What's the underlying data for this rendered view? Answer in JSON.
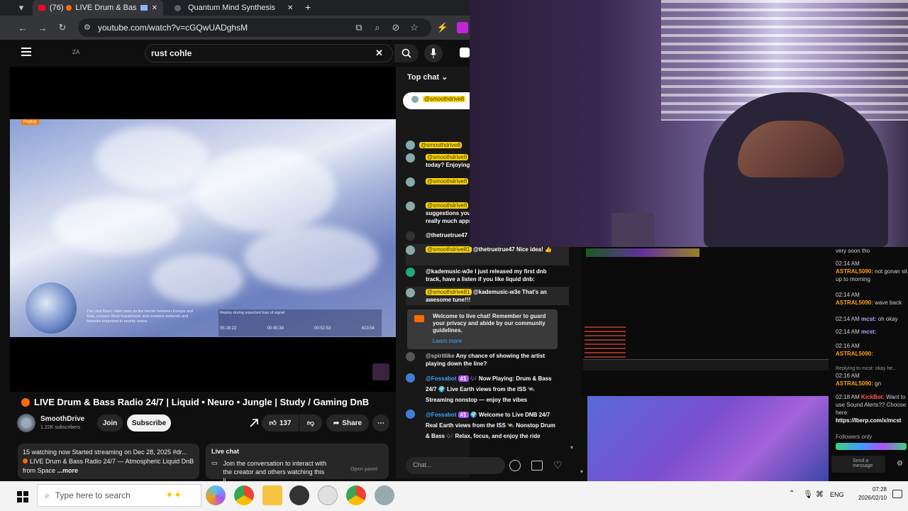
{
  "browser": {
    "tabs": [
      {
        "label": "(76)",
        "title": "LIVE Drum & Bass R",
        "active": true
      },
      {
        "label": "",
        "title": "Quantum Mind Synthesis",
        "active": false
      }
    ],
    "new_tab_glyph": "+",
    "close_glyph": "✕",
    "url": "youtube.com/watch?v=cGQwUADghsM"
  },
  "youtube": {
    "logo_text": "ZA",
    "search_value": "rust cohle",
    "video": {
      "replay_badge": "Replay",
      "overlay_caption": "The Ural River, often seen as the border between Europe and Asia, crosses West Kazakhstan and sustains wetlands and fisheries important to nearby towns.",
      "overlay_status": "Replay during expected loss of signal",
      "telemetry": [
        "05:28:22",
        "00:45:38",
        "00:52:53",
        "413:54"
      ]
    },
    "title": "LIVE Drum & Bass Radio 24/7 | Liquid • Neuro • Jungle | Study / Gaming DnB",
    "channel": "SmoothDrive",
    "subscribers": "1.22K subscribers",
    "join_label": "Join",
    "subscribe_label": "Subscribe",
    "like_count": "137",
    "share_label": "Share",
    "description": {
      "line1": "15 watching now  Started streaming on Dec 28, 2025  #dr...",
      "line2": "LIVE Drum & Bass Radio 24/7 — Atmospheric Liquid DnB",
      "line3": "from Space",
      "more": "...more"
    },
    "live_chat_box": {
      "title": "Live chat",
      "text": "Join the conversation to interact with the creator and others watching this li...",
      "open_panel": "Open panel"
    }
  },
  "chat": {
    "header": "Top chat",
    "pinned": "@smoothdrive8",
    "messages": [
      {
        "user": "@smoothdrive8",
        "text": ""
      },
      {
        "user": "@smoothdrive8",
        "text": "today? Enjoying"
      },
      {
        "user": "@smoothdrive8",
        "text": ""
      },
      {
        "user": "@smoothdrive8",
        "text": "suggestions you really much appr"
      },
      {
        "user": "@thetruetrue47",
        "text": ""
      },
      {
        "user": "@smoothdrive81",
        "text": "@thetruetrue47 Nice idea! 👍"
      },
      {
        "user": "@kademusic-w3e",
        "text": "I just released my first dnb track, have a listen if you like liquid dnb:"
      },
      {
        "user": "@smoothdrive81",
        "text": "@kademusic-w3e That's an awesome tune!!!"
      }
    ],
    "welcome": "Welcome to live chat! Remember to guard your privacy and abide by our community guidelines.",
    "learn_more": "Learn more",
    "later_messages": [
      {
        "user": "@spiritlike",
        "text": "Any chance of showing the artist playing down the line?"
      },
      {
        "user": "@Fossabot",
        "badge": "#1",
        "text": "🎶 Now Playing: Drum & Bass 24/7 🌍 Live Earth views from the ISS 🛰️ Streaming nonstop — enjoy the vibes"
      },
      {
        "user": "@Fossabot",
        "badge": "#1",
        "text": "🌍 Welcome to Live DNB 24/7 Real Earth views from the ISS 🛰️ Nonstop Drum & Bass 🎶 Relax, focus, and enjoy the ride"
      }
    ],
    "input_placeholder": "Chat..."
  },
  "kick_chat": {
    "top_text": "very soon tho",
    "messages": [
      {
        "time": "02:14 AM",
        "user": "ASTRAL5090:",
        "text": "not gonan sit up to morning"
      },
      {
        "time": "02:14 AM",
        "user": "ASTRAL5090:",
        "text": "wave back"
      },
      {
        "time": "02:14 AM",
        "user": "mcst:",
        "text": "oh okay"
      },
      {
        "time": "02:14 AM",
        "user": "mcst:",
        "text": ""
      },
      {
        "time": "02:16 AM",
        "user": "ASTRAL5090:",
        "text": ""
      },
      {
        "time": "02:16 AM",
        "user": "ASTRAL5090:",
        "text": "gn",
        "reply": "Replying to mcst: okay he..."
      },
      {
        "time": "02:18 AM",
        "user": "KickBot:",
        "text": "Want to use Sound Alerts?? Choose here:"
      }
    ],
    "link": "https://lberp.com/x/mcst",
    "followers_only": "Followers only",
    "send_placeholder": "Send a message"
  },
  "taskbar": {
    "search_placeholder": "Type here to search",
    "language": "ENG",
    "time": "07:28",
    "date": "2026/02/10"
  },
  "colors": {
    "yt_bg": "#0f0f0f",
    "chip_yellow": "#ffd600",
    "kick_orange": "#ff9f1c",
    "link_blue": "#3ea6ff"
  }
}
